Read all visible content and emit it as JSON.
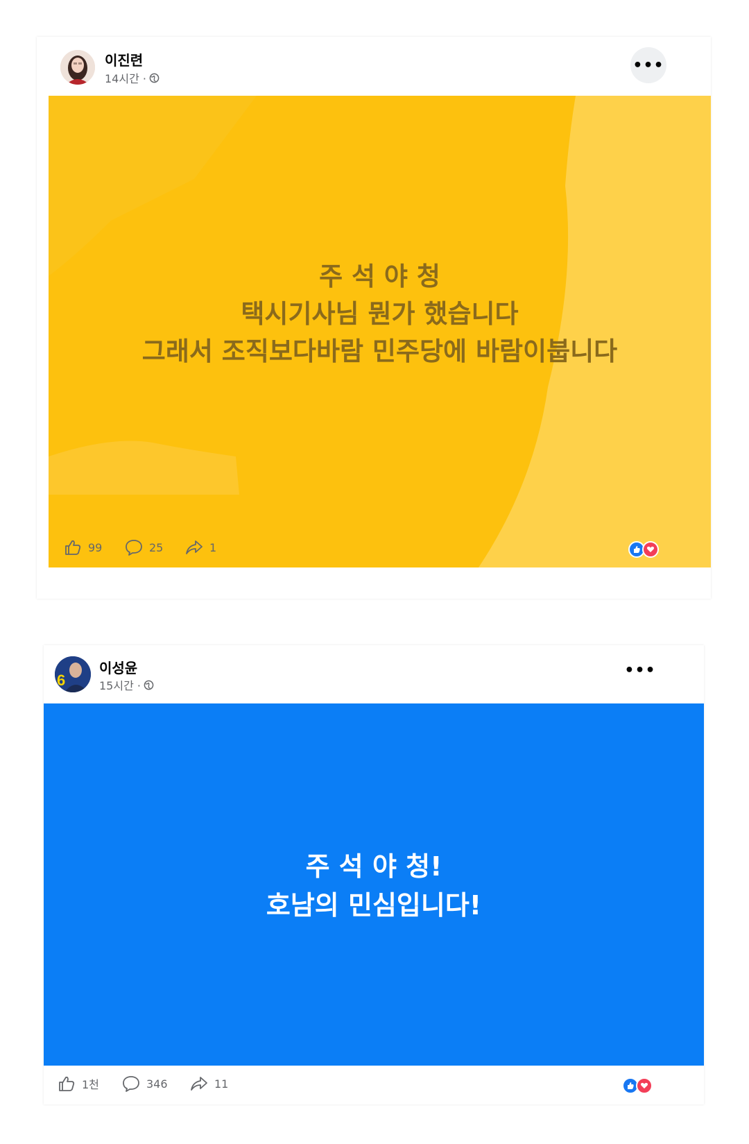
{
  "posts": [
    {
      "author": "이진련",
      "time": "14시간 · ",
      "card_bg": "#fdc10e",
      "card_text_color": "#8a6a1c",
      "card_lines": [
        "주 석 야 청",
        "택시기사님 뭔가 했습니다",
        "그래서 조직보다바람 민주당에 바람이붑니다"
      ],
      "likes": "99",
      "comments": "25",
      "shares": "1"
    },
    {
      "author": "이성윤",
      "time": "15시간 · ",
      "card_bg": "#0b7ef6",
      "card_text_color": "#ffffff",
      "card_lines": [
        "주 석 야 청!",
        "호남의 민심입니다!"
      ],
      "likes": "1천",
      "comments": "346",
      "shares": "11"
    }
  ],
  "icons": {
    "more": "more-options-icon",
    "globe": "globe-icon",
    "like": "thumbs-up-icon",
    "comment": "comment-icon",
    "share": "share-icon",
    "reaction_like": "like-reaction-icon",
    "reaction_love": "love-reaction-icon"
  },
  "colors": {
    "like_blue": "#1877f2",
    "love_red": "#f33e58"
  }
}
